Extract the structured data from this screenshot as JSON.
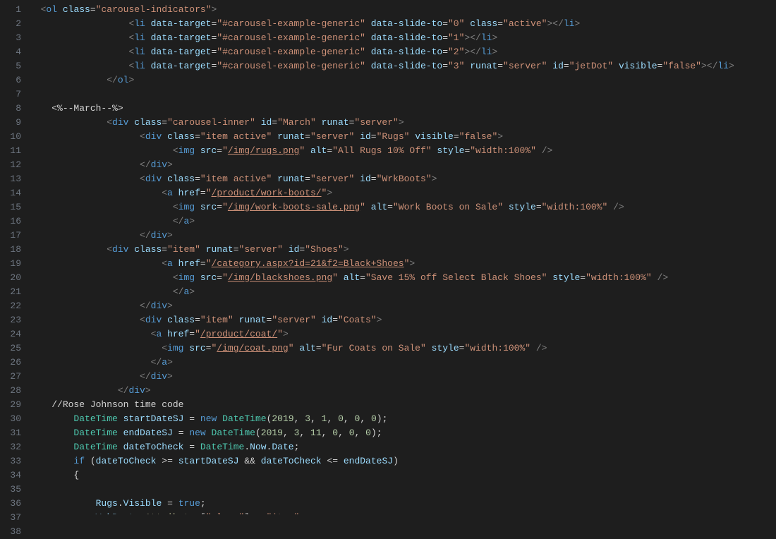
{
  "lineCount": 38,
  "lines": {
    "l1": "  <span class='p'>&lt;</span><span class='tg'>ol</span> <span class='at'>class</span><span class='eq'>=</span><span class='st'>\"carousel-indicators\"</span><span class='p'>&gt;</span>",
    "l2": "                  <span class='p'>&lt;</span><span class='tg'>li</span> <span class='at'>data-target</span><span class='eq'>=</span><span class='st'>\"#carousel-example-generic\"</span> <span class='at'>data-slide-to</span><span class='eq'>=</span><span class='st'>\"0\"</span> <span class='at'>class</span><span class='eq'>=</span><span class='st'>\"active\"</span><span class='p'>&gt;&lt;/</span><span class='tg'>li</span><span class='p'>&gt;</span>",
    "l3": "                  <span class='p'>&lt;</span><span class='tg'>li</span> <span class='at'>data-target</span><span class='eq'>=</span><span class='st'>\"#carousel-example-generic\"</span> <span class='at'>data-slide-to</span><span class='eq'>=</span><span class='st'>\"1\"</span><span class='p'>&gt;&lt;/</span><span class='tg'>li</span><span class='p'>&gt;</span>",
    "l4": "                  <span class='p'>&lt;</span><span class='tg'>li</span> <span class='at'>data-target</span><span class='eq'>=</span><span class='st'>\"#carousel-example-generic\"</span> <span class='at'>data-slide-to</span><span class='eq'>=</span><span class='st'>\"2\"</span><span class='p'>&gt;&lt;/</span><span class='tg'>li</span><span class='p'>&gt;</span>",
    "l5": "                  <span class='p'>&lt;</span><span class='tg'>li</span> <span class='at'>data-target</span><span class='eq'>=</span><span class='st'>\"#carousel-example-generic\"</span> <span class='at'>data-slide-to</span><span class='eq'>=</span><span class='st'>\"3\"</span> <span class='at'>runat</span><span class='eq'>=</span><span class='st'>\"server\"</span> <span class='at'>id</span><span class='eq'>=</span><span class='st'>\"jetDot\"</span> <span class='at'>visible</span><span class='eq'>=</span><span class='st'>\"false\"</span><span class='p'>&gt;&lt;/</span><span class='tg'>li</span><span class='p'>&gt;</span>",
    "l6": "              <span class='p'>&lt;/</span><span class='tg'>ol</span><span class='p'>&gt;</span>",
    "l7": "",
    "l8": "    <span class='cm'>&lt;%--March--%&gt;</span>",
    "l9": "              <span class='p'>&lt;</span><span class='tg'>div</span> <span class='at'>class</span><span class='eq'>=</span><span class='st'>\"carousel-inner\"</span> <span class='at'>id</span><span class='eq'>=</span><span class='st'>\"March\"</span> <span class='at'>runat</span><span class='eq'>=</span><span class='st'>\"server\"</span><span class='p'>&gt;</span>",
    "l10": "                    <span class='p'>&lt;</span><span class='tg'>div</span> <span class='at'>class</span><span class='eq'>=</span><span class='st'>\"item active\"</span> <span class='at'>runat</span><span class='eq'>=</span><span class='st'>\"server\"</span> <span class='at'>id</span><span class='eq'>=</span><span class='st'>\"Rugs\"</span> <span class='at'>visible</span><span class='eq'>=</span><span class='st'>\"false\"</span><span class='p'>&gt;</span>",
    "l11": "                          <span class='p'>&lt;</span><span class='tg'>img</span> <span class='at'>src</span><span class='eq'>=</span><span class='st'>\"</span><span class='st ul'>/img/rugs.png</span><span class='st'>\"</span> <span class='at'>alt</span><span class='eq'>=</span><span class='st'>\"All Rugs 10% Off\"</span> <span class='at'>style</span><span class='eq'>=</span><span class='st'>\"width:100%\"</span> <span class='p'>/&gt;</span>",
    "l12": "                    <span class='p'>&lt;/</span><span class='tg'>div</span><span class='p'>&gt;</span>",
    "l13": "                    <span class='p'>&lt;</span><span class='tg'>div</span> <span class='at'>class</span><span class='eq'>=</span><span class='st'>\"item active\"</span> <span class='at'>runat</span><span class='eq'>=</span><span class='st'>\"server\"</span> <span class='at'>id</span><span class='eq'>=</span><span class='st'>\"WrkBoots\"</span><span class='p'>&gt;</span>",
    "l14": "                        <span class='p'>&lt;</span><span class='tg'>a</span> <span class='at'>href</span><span class='eq'>=</span><span class='st'>\"</span><span class='st ul'>/product/work-boots/</span><span class='st'>\"</span><span class='p'>&gt;</span>",
    "l15": "                          <span class='p'>&lt;</span><span class='tg'>img</span> <span class='at'>src</span><span class='eq'>=</span><span class='st'>\"</span><span class='st ul'>/img/work-boots-sale.png</span><span class='st'>\"</span> <span class='at'>alt</span><span class='eq'>=</span><span class='st'>\"Work Boots on Sale\"</span> <span class='at'>style</span><span class='eq'>=</span><span class='st'>\"width:100%\"</span> <span class='p'>/&gt;</span>",
    "l16": "                          <span class='p'>&lt;/</span><span class='tg'>a</span><span class='p'>&gt;</span>",
    "l17": "                    <span class='p'>&lt;/</span><span class='tg'>div</span><span class='p'>&gt;</span>",
    "l18": "              <span class='p'>&lt;</span><span class='tg'>div</span> <span class='at'>class</span><span class='eq'>=</span><span class='st'>\"item\"</span> <span class='at'>runat</span><span class='eq'>=</span><span class='st'>\"server\"</span> <span class='at'>id</span><span class='eq'>=</span><span class='st'>\"Shoes\"</span><span class='p'>&gt;</span>",
    "l19": "                        <span class='p'>&lt;</span><span class='tg'>a</span> <span class='at'>href</span><span class='eq'>=</span><span class='st'>\"</span><span class='st ul'>/category.aspx?id=21&amp;f2=Black+Shoes</span><span class='st'>\"</span><span class='p'>&gt;</span>",
    "l20": "                          <span class='p'>&lt;</span><span class='tg'>img</span> <span class='at'>src</span><span class='eq'>=</span><span class='st'>\"</span><span class='st ul'>/img/blackshoes.png</span><span class='st'>\"</span> <span class='at'>alt</span><span class='eq'>=</span><span class='st'>\"Save 15% off Select Black Shoes\"</span> <span class='at'>style</span><span class='eq'>=</span><span class='st'>\"width:100%\"</span> <span class='p'>/&gt;</span>",
    "l21": "                          <span class='p'>&lt;/</span><span class='tg'>a</span><span class='p'>&gt;</span>",
    "l22": "                    <span class='p'>&lt;/</span><span class='tg'>div</span><span class='p'>&gt;</span>",
    "l23": "                    <span class='p'>&lt;</span><span class='tg'>div</span> <span class='at'>class</span><span class='eq'>=</span><span class='st'>\"item\"</span> <span class='at'>runat</span><span class='eq'>=</span><span class='st'>\"server\"</span> <span class='at'>id</span><span class='eq'>=</span><span class='st'>\"Coats\"</span><span class='p'>&gt;</span>",
    "l24": "                      <span class='p'>&lt;</span><span class='tg'>a</span> <span class='at'>href</span><span class='eq'>=</span><span class='st'>\"</span><span class='st ul'>/product/coat/</span><span class='st'>\"</span><span class='p'>&gt;</span>",
    "l25": "                        <span class='p'>&lt;</span><span class='tg'>img</span> <span class='at'>src</span><span class='eq'>=</span><span class='st'>\"</span><span class='st ul'>/img/coat.png</span><span class='st'>\"</span> <span class='at'>alt</span><span class='eq'>=</span><span class='st'>\"Fur Coats on Sale\"</span> <span class='at'>style</span><span class='eq'>=</span><span class='st'>\"width:100%\"</span> <span class='p'>/&gt;</span>",
    "l26": "                      <span class='p'>&lt;/</span><span class='tg'>a</span><span class='p'>&gt;</span>",
    "l27": "                    <span class='p'>&lt;/</span><span class='tg'>div</span><span class='p'>&gt;</span>",
    "l28": "                <span class='p'>&lt;/</span><span class='tg'>div</span><span class='p'>&gt;</span>",
    "l29": "    <span class='tx'>//Rose Johnson time code</span>",
    "l30": "        <span class='ty'>DateTime</span> <span class='id'>startDateSJ</span> <span class='tx'>=</span> <span class='kw'>new</span> <span class='ty'>DateTime</span><span class='tx'>(</span><span class='nm'>2019</span><span class='tx'>,</span> <span class='nm'>3</span><span class='tx'>,</span> <span class='nm'>1</span><span class='tx'>,</span> <span class='nm'>0</span><span class='tx'>,</span> <span class='nm'>0</span><span class='tx'>,</span> <span class='nm'>0</span><span class='tx'>);</span>",
    "l31": "        <span class='ty'>DateTime</span> <span class='id'>endDateSJ</span> <span class='tx'>=</span> <span class='kw'>new</span> <span class='ty'>DateTime</span><span class='tx'>(</span><span class='nm'>2019</span><span class='tx'>,</span> <span class='nm'>3</span><span class='tx'>,</span> <span class='nm'>11</span><span class='tx'>,</span> <span class='nm'>0</span><span class='tx'>,</span> <span class='nm'>0</span><span class='tx'>,</span> <span class='nm'>0</span><span class='tx'>);</span>",
    "l32": "        <span class='ty'>DateTime</span> <span class='id'>dateToCheck</span> <span class='tx'>=</span> <span class='ty'>DateTime</span><span class='tx'>.</span><span class='id'>Now</span><span class='tx'>.</span><span class='id'>Date</span><span class='tx'>;</span>",
    "l33": "        <span class='kw'>if</span> <span class='tx'>(</span><span class='id'>dateToCheck</span> <span class='tx'>&gt;=</span> <span class='id'>startDateSJ</span> <span class='tx'>&amp;&amp;</span> <span class='id'>dateToCheck</span> <span class='tx'>&lt;=</span> <span class='id'>endDateSJ</span><span class='tx'>)</span>",
    "l34": "        <span class='tx'>{</span>",
    "l35": "",
    "l36": "            <span class='id'>Rugs</span><span class='tx'>.</span><span class='id'>Visible</span> <span class='tx'>=</span> <span class='kw'>true</span><span class='tx'>;</span>",
    "l37": "            <span class='id'>WrkBoots</span><span class='tx'>.</span><span class='fn'>Attributes</span><span class='tx'>[</span><span class='st'>\"class\"</span><span class='tx'>]</span> <span class='tx'>=</span> <span class='st'>\"item\"</span><span class='tx'>;</span>",
    "l38": "        <span class='tx'>}</span>"
  }
}
